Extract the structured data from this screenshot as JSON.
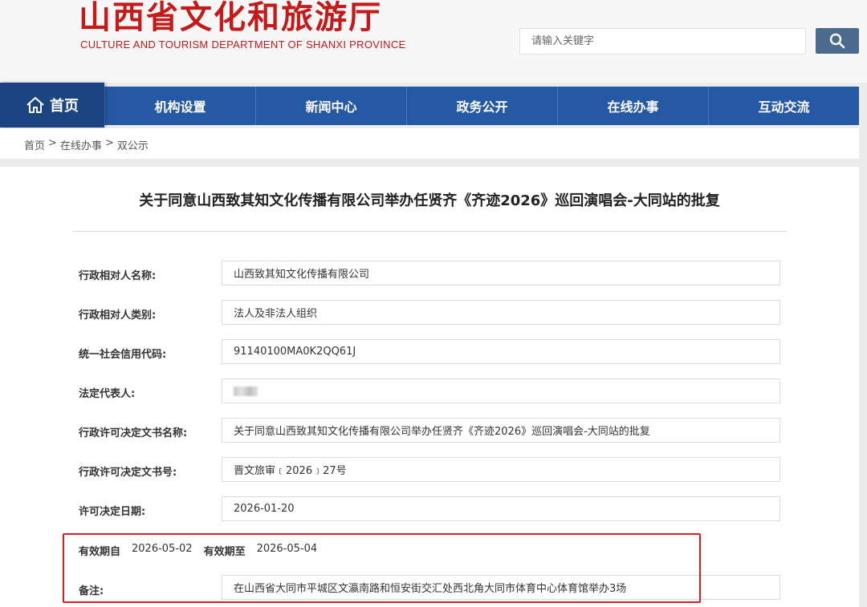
{
  "header": {
    "logo_cn": "山西省文化和旅游厅",
    "logo_en": "CULTURE AND TOURISM DEPARTMENT OF SHANXI PROVINCE",
    "search_placeholder": "请输入关键字",
    "brand_color": "#c41a1a"
  },
  "nav": {
    "home": "首页",
    "items": [
      "机构设置",
      "新闻中心",
      "政务公开",
      "在线办事",
      "互动交流"
    ],
    "bg_color": "#2559a3"
  },
  "breadcrumb": {
    "items": [
      "首页",
      "在线办事",
      "双公示"
    ],
    "separator": ">"
  },
  "document": {
    "title": "关于同意山西致其知文化传播有限公司举办任贤齐《齐迹2026》巡回演唱会-大同站的批复",
    "fields": [
      {
        "label": "行政相对人名称:",
        "value": "山西致其知文化传播有限公司"
      },
      {
        "label": "行政相对人类别:",
        "value": "法人及非法人组织"
      },
      {
        "label": "统一社会信用代码:",
        "value": "91140100MA0K2QQ61J"
      },
      {
        "label": "法定代表人:",
        "value": ""
      },
      {
        "label": "行政许可决定文书名称:",
        "value": "关于同意山西致其知文化传播有限公司举办任贤齐《齐迹2026》巡回演唱会-大同站的批复"
      },
      {
        "label": "行政许可决定文书号:",
        "value": "晋文旅审﹝2026﹞27号"
      },
      {
        "label": "许可决定日期:",
        "value": "2026-01-20"
      }
    ],
    "validity": {
      "from_label": "有效期自",
      "from_value": "2026-05-02",
      "to_label": "有效期至",
      "to_value": "2026-05-04"
    },
    "remark": {
      "label": "备注:",
      "value": "在山西省大同市平城区文瀛南路和恒安街交汇处西北角大同市体育中心体育馆举办3场"
    },
    "highlight_color": "#e01d1d"
  }
}
